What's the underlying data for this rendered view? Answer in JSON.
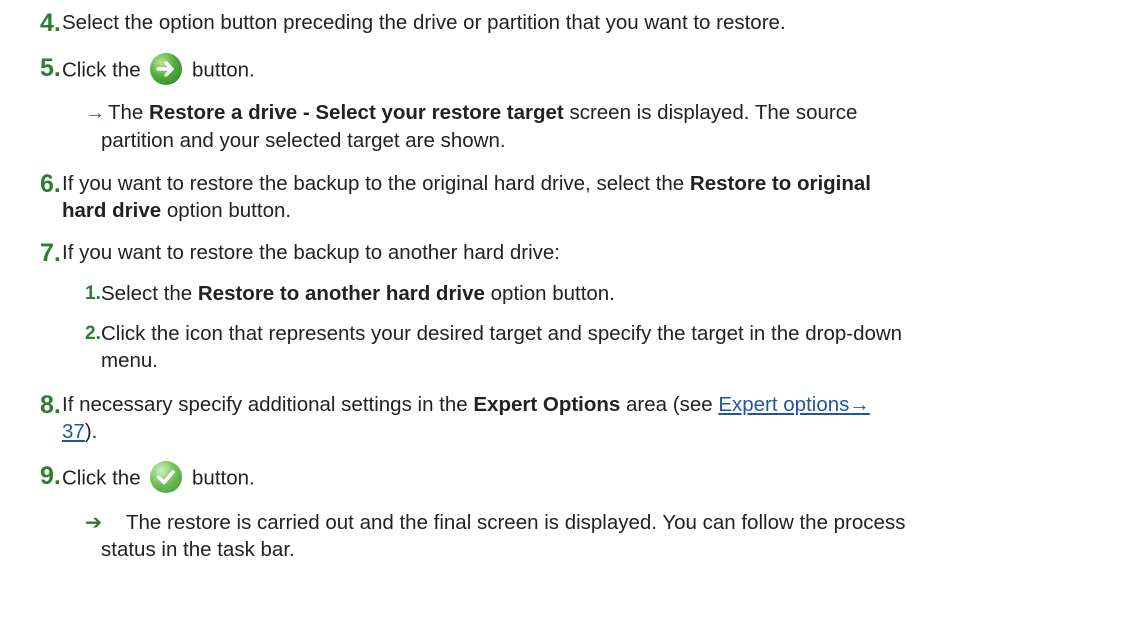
{
  "steps": [
    {
      "number": "4.",
      "text": "Select the option button preceding the drive or partition that you want to restore."
    },
    {
      "number": "5.",
      "before": "Click the",
      "after": "button.",
      "icon": "next-arrow-icon",
      "result_marker": "→",
      "result_pre": "The",
      "result_bold": "Restore a drive - Select your restore target",
      "result_post": "screen is displayed. The source",
      "result_line2": "partition and your selected target are shown."
    },
    {
      "number": "6.",
      "line1_pre": "If you want to restore the backup to the original hard drive, select the",
      "line1_bold": "Restore to original",
      "line2_bold": "hard drive",
      "line2_post": "option button."
    },
    {
      "number": "7.",
      "text": "If you want to restore the backup to another hard drive:",
      "sub": [
        {
          "number": "1.",
          "pre": "Select the",
          "bold": "Restore to another hard drive",
          "post": "option button."
        },
        {
          "number": "2.",
          "line1": "Click the icon that represents your desired target and specify the target in the drop-down",
          "line2": "menu."
        }
      ]
    },
    {
      "number": "8.",
      "pre": "If necessary specify additional settings in the",
      "bold": "Expert Options",
      "mid": "area (see",
      "link1": "Expert options→",
      "link2": "37",
      "post": ")."
    },
    {
      "number": "9.",
      "before": "Click the",
      "after": "button.",
      "icon": "checkmark-icon",
      "result_marker": "➔",
      "result_line1": "The restore is carried out and the final screen is displayed. You can follow the process",
      "result_line2": "status in the task bar."
    }
  ],
  "colors": {
    "accent": "#2f7d32",
    "link": "#2155a3",
    "text": "#222222"
  }
}
